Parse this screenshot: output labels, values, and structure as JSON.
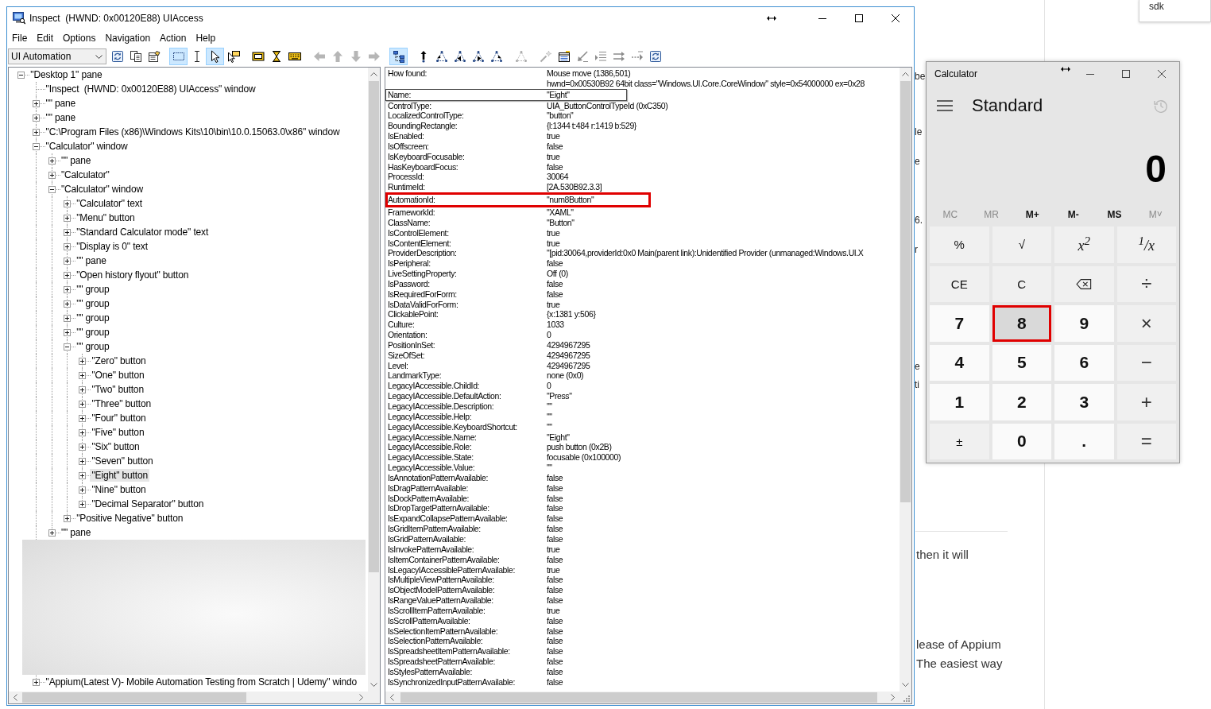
{
  "inspect": {
    "title": "Inspect  (HWND: 0x00120E88) UIAccess",
    "menu": [
      "File",
      "Edit",
      "Options",
      "Navigation",
      "Action",
      "Help"
    ],
    "toolbar": {
      "mode": "UI Automation",
      "groups": [
        [
          {
            "kind": "refresh",
            "selected": false,
            "disabled": false
          },
          {
            "kind": "copy",
            "selected": false,
            "disabled": false
          },
          {
            "kind": "properties",
            "selected": false,
            "disabled": false
          }
        ],
        [
          {
            "kind": "dashed-rect",
            "selected": true,
            "disabled": false
          },
          {
            "kind": "text-cursor",
            "selected": false,
            "disabled": false
          },
          {
            "kind": "pointer",
            "selected": true,
            "disabled": false
          },
          {
            "kind": "pointer-tooltip",
            "selected": false,
            "disabled": false
          }
        ],
        [
          {
            "kind": "highlight-rect",
            "selected": false,
            "disabled": false
          },
          {
            "kind": "hourglass",
            "selected": false,
            "disabled": false
          },
          {
            "kind": "keyboard",
            "selected": false,
            "disabled": false
          }
        ],
        [
          {
            "kind": "arrow-left",
            "selected": false,
            "disabled": true
          },
          {
            "kind": "arrow-up",
            "selected": false,
            "disabled": true
          },
          {
            "kind": "arrow-down",
            "selected": false,
            "disabled": true
          },
          {
            "kind": "arrow-right",
            "selected": false,
            "disabled": true
          }
        ],
        [
          {
            "kind": "tree",
            "selected": true,
            "disabled": false
          }
        ],
        [
          {
            "kind": "parent",
            "selected": false,
            "disabled": false
          },
          {
            "kind": "first-child",
            "selected": false,
            "disabled": false
          },
          {
            "kind": "prev-sibling",
            "selected": false,
            "disabled": false
          },
          {
            "kind": "next-sibling",
            "selected": false,
            "disabled": false
          },
          {
            "kind": "last-child",
            "selected": false,
            "disabled": false
          }
        ],
        [
          {
            "kind": "node-triangle",
            "selected": false,
            "disabled": true
          }
        ],
        [
          {
            "kind": "wand",
            "selected": false,
            "disabled": true
          },
          {
            "kind": "list-edit",
            "selected": false,
            "disabled": false
          },
          {
            "kind": "arrow-down-left",
            "selected": false,
            "disabled": true
          },
          {
            "kind": "list-arrow",
            "selected": false,
            "disabled": true
          },
          {
            "kind": "double-arrow-right",
            "selected": false,
            "disabled": true
          },
          {
            "kind": "dashed-arrow-right",
            "selected": false,
            "disabled": true
          },
          {
            "kind": "refresh",
            "selected": false,
            "disabled": false
          }
        ]
      ]
    },
    "tree": [
      {
        "label": "\"Desktop 1\" pane",
        "expandable": true,
        "expanded": true,
        "selected": false,
        "children": [
          {
            "label": "\"Inspect  (HWND: 0x00120E88) UIAccess\" window",
            "expandable": false,
            "expanded": false,
            "selected": false
          },
          {
            "label": "\"\" pane",
            "expandable": true,
            "expanded": false,
            "selected": false
          },
          {
            "label": "\"\" pane",
            "expandable": true,
            "expanded": false,
            "selected": false
          },
          {
            "label": "\"C:\\Program Files (x86)\\Windows Kits\\10\\bin\\10.0.15063.0\\x86\" window",
            "expandable": true,
            "expanded": false,
            "selected": false
          },
          {
            "label": "\"Calculator\" window",
            "expandable": true,
            "expanded": true,
            "selected": false,
            "children": [
              {
                "label": "\"\" pane",
                "expandable": true,
                "expanded": false,
                "selected": false
              },
              {
                "label": "\"Calculator\"",
                "expandable": true,
                "expanded": false,
                "selected": false
              },
              {
                "label": "\"Calculator\" window",
                "expandable": true,
                "expanded": true,
                "selected": false,
                "children": [
                  {
                    "label": "\"Calculator\" text",
                    "expandable": true,
                    "expanded": false,
                    "selected": false
                  },
                  {
                    "label": "\"Menu\" button",
                    "expandable": true,
                    "expanded": false,
                    "selected": false
                  },
                  {
                    "label": "\"Standard Calculator mode\" text",
                    "expandable": true,
                    "expanded": false,
                    "selected": false
                  },
                  {
                    "label": "\"Display is 0\" text",
                    "expandable": true,
                    "expanded": false,
                    "selected": false
                  },
                  {
                    "label": "\"\" pane",
                    "expandable": true,
                    "expanded": false,
                    "selected": false
                  },
                  {
                    "label": "\"Open history flyout\" button",
                    "expandable": true,
                    "expanded": false,
                    "selected": false
                  },
                  {
                    "label": "\"\" group",
                    "expandable": true,
                    "expanded": false,
                    "selected": false
                  },
                  {
                    "label": "\"\" group",
                    "expandable": true,
                    "expanded": false,
                    "selected": false
                  },
                  {
                    "label": "\"\" group",
                    "expandable": true,
                    "expanded": false,
                    "selected": false
                  },
                  {
                    "label": "\"\" group",
                    "expandable": true,
                    "expanded": false,
                    "selected": false
                  },
                  {
                    "label": "\"\" group",
                    "expandable": true,
                    "expanded": true,
                    "selected": false,
                    "children": [
                      {
                        "label": "\"Zero\" button",
                        "expandable": true,
                        "expanded": false,
                        "selected": false
                      },
                      {
                        "label": "\"One\" button",
                        "expandable": true,
                        "expanded": false,
                        "selected": false
                      },
                      {
                        "label": "\"Two\" button",
                        "expandable": true,
                        "expanded": false,
                        "selected": false
                      },
                      {
                        "label": "\"Three\" button",
                        "expandable": true,
                        "expanded": false,
                        "selected": false
                      },
                      {
                        "label": "\"Four\" button",
                        "expandable": true,
                        "expanded": false,
                        "selected": false
                      },
                      {
                        "label": "\"Five\" button",
                        "expandable": true,
                        "expanded": false,
                        "selected": false
                      },
                      {
                        "label": "\"Six\" button",
                        "expandable": true,
                        "expanded": false,
                        "selected": false
                      },
                      {
                        "label": "\"Seven\" button",
                        "expandable": true,
                        "expanded": false,
                        "selected": false
                      },
                      {
                        "label": "\"Eight\" button",
                        "expandable": true,
                        "expanded": false,
                        "selected": true
                      },
                      {
                        "label": "\"Nine\" button",
                        "expandable": true,
                        "expanded": false,
                        "selected": false
                      },
                      {
                        "label": "\"Decimal Separator\" button",
                        "expandable": true,
                        "expanded": false,
                        "selected": false
                      }
                    ]
                  },
                  {
                    "label": "\"Positive Negative\" button",
                    "expandable": true,
                    "expanded": false,
                    "selected": false
                  }
                ]
              },
              {
                "label": "\"\" pane",
                "expandable": true,
                "expanded": false,
                "selected": false
              }
            ]
          },
          {
            "label": "\"Appium(Latest V)- Mobile Automation Testing from Scratch | Udemy\" windo",
            "expandable": true,
            "expanded": false,
            "selected": false
          }
        ]
      }
    ],
    "properties": [
      {
        "name": "How found:",
        "value": "Mouse move (1386,501)",
        "highlighted": false,
        "annotated": false
      },
      {
        "value": "hwnd=0x00530B92 64bit class=\"Windows.UI.Core.CoreWindow\" style=0x54000000 ex=0x28",
        "highlighted": false,
        "annotated": false
      },
      {
        "name": "Name:",
        "value": "\"Eight\"",
        "highlighted": true,
        "annotated": false
      },
      {
        "name": "ControlType:",
        "value": "UIA_ButtonControlTypeId (0xC350)",
        "highlighted": false,
        "annotated": false
      },
      {
        "name": "LocalizedControlType:",
        "value": "\"button\"",
        "highlighted": false,
        "annotated": false
      },
      {
        "name": "BoundingRectangle:",
        "value": "{l:1344 t:484 r:1419 b:529}",
        "highlighted": false,
        "annotated": false
      },
      {
        "name": "IsEnabled:",
        "value": "true",
        "highlighted": false,
        "annotated": false
      },
      {
        "name": "IsOffscreen:",
        "value": "false",
        "highlighted": false,
        "annotated": false
      },
      {
        "name": "IsKeyboardFocusable:",
        "value": "true",
        "highlighted": false,
        "annotated": false
      },
      {
        "name": "HasKeyboardFocus:",
        "value": "false",
        "highlighted": false,
        "annotated": false
      },
      {
        "name": "ProcessId:",
        "value": "30064",
        "highlighted": false,
        "annotated": false
      },
      {
        "name": "RuntimeId:",
        "value": "[2A.530B92.3.3]",
        "highlighted": false,
        "annotated": false
      },
      {
        "name": "AutomationId:",
        "value": "\"num8Button\"",
        "highlighted": false,
        "annotated": true
      },
      {
        "name": "FrameworkId:",
        "value": "\"XAML\"",
        "highlighted": false,
        "annotated": false
      },
      {
        "name": "ClassName:",
        "value": "\"Button\"",
        "highlighted": false,
        "annotated": false
      },
      {
        "name": "IsControlElement:",
        "value": "true",
        "highlighted": false,
        "annotated": false
      },
      {
        "name": "IsContentElement:",
        "value": "true",
        "highlighted": false,
        "annotated": false
      },
      {
        "name": "ProviderDescription:",
        "value": "\"[pid:30064,providerId:0x0 Main(parent link):Unidentified Provider (unmanaged:Windows.UI.X",
        "highlighted": false,
        "annotated": false
      },
      {
        "name": "IsPeripheral:",
        "value": "false",
        "highlighted": false,
        "annotated": false
      },
      {
        "name": "LiveSettingProperty:",
        "value": "Off (0)",
        "highlighted": false,
        "annotated": false
      },
      {
        "name": "IsPassword:",
        "value": "false",
        "highlighted": false,
        "annotated": false
      },
      {
        "name": "IsRequiredForForm:",
        "value": "false",
        "highlighted": false,
        "annotated": false
      },
      {
        "name": "IsDataValidForForm:",
        "value": "true",
        "highlighted": false,
        "annotated": false
      },
      {
        "name": "ClickablePoint:",
        "value": "{x:1381 y:506}",
        "highlighted": false,
        "annotated": false
      },
      {
        "name": "Culture:",
        "value": "1033",
        "highlighted": false,
        "annotated": false
      },
      {
        "name": "Orientation:",
        "value": "0",
        "highlighted": false,
        "annotated": false
      },
      {
        "name": "PositionInSet:",
        "value": "4294967295",
        "highlighted": false,
        "annotated": false
      },
      {
        "name": "SizeOfSet:",
        "value": "4294967295",
        "highlighted": false,
        "annotated": false
      },
      {
        "name": "Level:",
        "value": "4294967295",
        "highlighted": false,
        "annotated": false
      },
      {
        "name": "LandmarkType:",
        "value": "none (0x0)",
        "highlighted": false,
        "annotated": false
      },
      {
        "name": "LegacyIAccessible.ChildId:",
        "value": "0",
        "highlighted": false,
        "annotated": false
      },
      {
        "name": "LegacyIAccessible.DefaultAction:",
        "value": "\"Press\"",
        "highlighted": false,
        "annotated": false
      },
      {
        "name": "LegacyIAccessible.Description:",
        "value": "\"\"",
        "highlighted": false,
        "annotated": false
      },
      {
        "name": "LegacyIAccessible.Help:",
        "value": "\"\"",
        "highlighted": false,
        "annotated": false
      },
      {
        "name": "LegacyIAccessible.KeyboardShortcut:",
        "value": "\"\"",
        "highlighted": false,
        "annotated": false
      },
      {
        "name": "LegacyIAccessible.Name:",
        "value": "\"Eight\"",
        "highlighted": false,
        "annotated": false
      },
      {
        "name": "LegacyIAccessible.Role:",
        "value": "push button (0x2B)",
        "highlighted": false,
        "annotated": false
      },
      {
        "name": "LegacyIAccessible.State:",
        "value": "focusable (0x100000)",
        "highlighted": false,
        "annotated": false
      },
      {
        "name": "LegacyIAccessible.Value:",
        "value": "\"\"",
        "highlighted": false,
        "annotated": false
      },
      {
        "name": "IsAnnotationPatternAvailable:",
        "value": "false",
        "highlighted": false,
        "annotated": false
      },
      {
        "name": "IsDragPatternAvailable:",
        "value": "false",
        "highlighted": false,
        "annotated": false
      },
      {
        "name": "IsDockPatternAvailable:",
        "value": "false",
        "highlighted": false,
        "annotated": false
      },
      {
        "name": "IsDropTargetPatternAvailable:",
        "value": "false",
        "highlighted": false,
        "annotated": false
      },
      {
        "name": "IsExpandCollapsePatternAvailable:",
        "value": "false",
        "highlighted": false,
        "annotated": false
      },
      {
        "name": "IsGridItemPatternAvailable:",
        "value": "false",
        "highlighted": false,
        "annotated": false
      },
      {
        "name": "IsGridPatternAvailable:",
        "value": "false",
        "highlighted": false,
        "annotated": false
      },
      {
        "name": "IsInvokePatternAvailable:",
        "value": "true",
        "highlighted": false,
        "annotated": false
      },
      {
        "name": "IsItemContainerPatternAvailable:",
        "value": "false",
        "highlighted": false,
        "annotated": false
      },
      {
        "name": "IsLegacyIAccessiblePatternAvailable:",
        "value": "true",
        "highlighted": false,
        "annotated": false
      },
      {
        "name": "IsMultipleViewPatternAvailable:",
        "value": "false",
        "highlighted": false,
        "annotated": false
      },
      {
        "name": "IsObjectModelPatternAvailable:",
        "value": "false",
        "highlighted": false,
        "annotated": false
      },
      {
        "name": "IsRangeValuePatternAvailable:",
        "value": "false",
        "highlighted": false,
        "annotated": false
      },
      {
        "name": "IsScrollItemPatternAvailable:",
        "value": "true",
        "highlighted": false,
        "annotated": false
      },
      {
        "name": "IsScrollPatternAvailable:",
        "value": "false",
        "highlighted": false,
        "annotated": false
      },
      {
        "name": "IsSelectionItemPatternAvailable:",
        "value": "false",
        "highlighted": false,
        "annotated": false
      },
      {
        "name": "IsSelectionPatternAvailable:",
        "value": "false",
        "highlighted": false,
        "annotated": false
      },
      {
        "name": "IsSpreadsheetItemPatternAvailable:",
        "value": "false",
        "highlighted": false,
        "annotated": false
      },
      {
        "name": "IsSpreadsheetPatternAvailable:",
        "value": "false",
        "highlighted": false,
        "annotated": false
      },
      {
        "name": "IsStylesPatternAvailable:",
        "value": "false",
        "highlighted": false,
        "annotated": false
      },
      {
        "name": "IsSynchronizedInputPatternAvailable:",
        "value": "false",
        "highlighted": false,
        "annotated": false
      }
    ]
  },
  "calculator": {
    "title": "Calculator",
    "mode": "Standard",
    "display": "0",
    "memory": [
      {
        "label": "MC",
        "disabled": true
      },
      {
        "label": "MR",
        "disabled": true
      },
      {
        "label": "M+",
        "disabled": false
      },
      {
        "label": "M-",
        "disabled": false
      },
      {
        "label": "MS",
        "disabled": false
      },
      {
        "label": "M˅",
        "disabled": true
      }
    ],
    "keys": [
      {
        "label": "%",
        "kind": "function",
        "hovered": false,
        "annotated": false
      },
      {
        "label": "√",
        "kind": "function",
        "hovered": false,
        "annotated": false
      },
      {
        "label": "x$^{2}$",
        "kind": "formula",
        "hovered": false,
        "annotated": false
      },
      {
        "label": "$^{1}$/x",
        "kind": "formula",
        "hovered": false,
        "annotated": false
      },
      {
        "label": "CE",
        "kind": "function",
        "hovered": false,
        "annotated": false
      },
      {
        "label": "C",
        "kind": "function",
        "hovered": false,
        "annotated": false
      },
      {
        "kind": "backspace",
        "hovered": false,
        "annotated": false
      },
      {
        "label": "÷",
        "kind": "operator",
        "hovered": false,
        "annotated": false
      },
      {
        "label": "7",
        "kind": "digit",
        "hovered": false,
        "annotated": false
      },
      {
        "label": "8",
        "kind": "digit",
        "hovered": true,
        "annotated": true
      },
      {
        "label": "9",
        "kind": "digit",
        "hovered": false,
        "annotated": false
      },
      {
        "label": "×",
        "kind": "operator",
        "hovered": false,
        "annotated": false
      },
      {
        "label": "4",
        "kind": "digit",
        "hovered": false,
        "annotated": false
      },
      {
        "label": "5",
        "kind": "digit",
        "hovered": false,
        "annotated": false
      },
      {
        "label": "6",
        "kind": "digit",
        "hovered": false,
        "annotated": false
      },
      {
        "label": "−",
        "kind": "operator",
        "hovered": false,
        "annotated": false
      },
      {
        "label": "1",
        "kind": "digit",
        "hovered": false,
        "annotated": false
      },
      {
        "label": "2",
        "kind": "digit",
        "hovered": false,
        "annotated": false
      },
      {
        "label": "3",
        "kind": "digit",
        "hovered": false,
        "annotated": false
      },
      {
        "label": "+",
        "kind": "operator",
        "hovered": false,
        "annotated": false
      },
      {
        "label": "±",
        "kind": "function",
        "hovered": false,
        "annotated": false
      },
      {
        "label": "0",
        "kind": "digit",
        "hovered": false,
        "annotated": false
      },
      {
        "label": ".",
        "kind": "digit",
        "hovered": false,
        "annotated": false
      },
      {
        "label": "=",
        "kind": "operator",
        "hovered": false,
        "annotated": false
      }
    ]
  },
  "background_page": {
    "side_fragments": [
      "be",
      "le",
      "e",
      "6.",
      "r",
      "e",
      "ti"
    ],
    "lines": [
      "then it will",
      "lease of Appium",
      "The easiest way"
    ],
    "suggestion": "sdk"
  }
}
